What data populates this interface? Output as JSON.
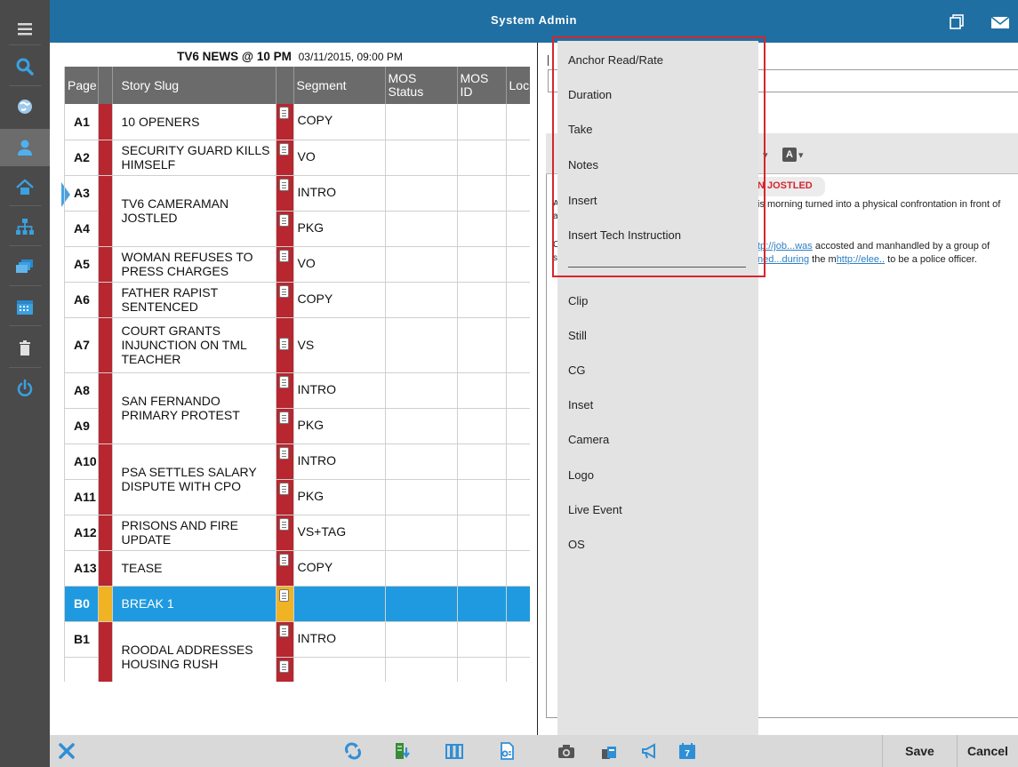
{
  "header": {
    "title": "System Admin",
    "icons": [
      "window-copy-icon",
      "mail-icon"
    ]
  },
  "sidebar": {
    "icons": [
      "menu-icon",
      "search-icon",
      "globe-icon",
      "user-icon",
      "home-icon",
      "network-icon",
      "stack-icon",
      "calendar-icon",
      "trash-icon",
      "power-icon"
    ],
    "active": "user-icon"
  },
  "rundown": {
    "show": "TV6 NEWS @ 10 PM",
    "datetime": "03/11/2015, 09:00 PM",
    "columns": [
      "Page",
      "Story Slug",
      "Segment",
      "MOS Status",
      "MOS ID",
      "Loc"
    ],
    "rows": [
      {
        "page": "A1",
        "slug": "10 OPENERS",
        "segment": "COPY"
      },
      {
        "page": "A2",
        "slug": "SECURITY GUARD KILLS HIMSELF",
        "segment": "VO"
      },
      {
        "page": "A3",
        "slug": "TV6 CAMERAMAN JOSTLED",
        "segment": "INTRO"
      },
      {
        "page": "A4",
        "slug": "",
        "segment": "PKG"
      },
      {
        "page": "A5",
        "slug": "WOMAN REFUSES TO PRESS CHARGES",
        "segment": "VO"
      },
      {
        "page": "A6",
        "slug": "FATHER RAPIST SENTENCED",
        "segment": "COPY"
      },
      {
        "page": "A7",
        "slug": "COURT GRANTS INJUNCTION ON TML TEACHER",
        "segment": "VS"
      },
      {
        "page": "A8",
        "slug": "SAN FERNANDO PRIMARY PROTEST",
        "segment": "INTRO"
      },
      {
        "page": "A9",
        "slug": "",
        "segment": "PKG"
      },
      {
        "page": "A10",
        "slug": "PSA SETTLES SALARY DISPUTE WITH CPO",
        "segment": "INTRO"
      },
      {
        "page": "A11",
        "slug": "",
        "segment": "PKG"
      },
      {
        "page": "A12",
        "slug": "PRISONS AND FIRE UPDATE",
        "segment": "VS+TAG"
      },
      {
        "page": "A13",
        "slug": "TEASE",
        "segment": "COPY"
      },
      {
        "page": "B0",
        "slug": "BREAK 1",
        "segment": ""
      },
      {
        "page": "B1",
        "slug": "ROODAL ADDRESSES HOUSING RUSH",
        "segment": "INTRO"
      }
    ]
  },
  "editor": {
    "heading": "N JOSTLED",
    "line1": "is morning turned into a physical confrontation in front of",
    "line2_link1": "tp://job...was",
    "line2_rest": " accosted and manhandled by a group of",
    "line3_link1": "ned...during",
    "line3_mid": " the m",
    "line3_link2": "http://elee..",
    "line3_rest": " to be a police officer.",
    "gutter_a": "A",
    "gutter_a2": "a",
    "gutter_c": "C",
    "gutter_s": "s"
  },
  "menu": {
    "items_highlighted": [
      "Anchor Read/Rate",
      "Duration",
      "Take",
      "Notes",
      "Insert",
      "Insert Tech Instruction"
    ],
    "items_other": [
      "Clip",
      "Still",
      "CG",
      "Inset",
      "Camera",
      "Logo",
      "Live Event",
      "OS"
    ]
  },
  "footer": {
    "save": "Save",
    "cancel": "Cancel"
  },
  "colors": {
    "header": "#1f6fa3",
    "sidebar": "#4a4a4a",
    "flag_red": "#b8262f",
    "flag_yellow": "#f0b323",
    "selected_row": "#1f9ae0",
    "highlight_border": "#d7262b",
    "link": "#2e7fc1"
  }
}
